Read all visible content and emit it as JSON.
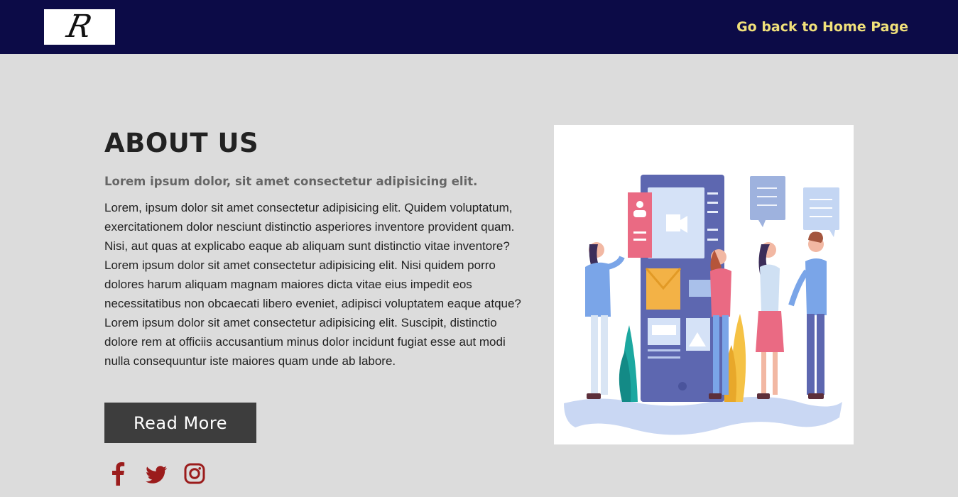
{
  "header": {
    "logo_letter": "R",
    "home_link": "Go back to Home Page"
  },
  "about": {
    "title": "ABOUT US",
    "subtitle": "Lorem ipsum dolor, sit amet consectetur adipisicing elit.",
    "body": "Lorem, ipsum dolor sit amet consectetur adipisicing elit. Quidem voluptatum, exercitationem dolor nesciunt distinctio asperiores inventore provident quam. Nisi, aut quas at explicabo eaque ab aliquam sunt distinctio vitae inventore? Lorem ipsum dolor sit amet consectetur adipisicing elit. Nisi quidem porro dolores harum aliquam magnam maiores dicta vitae eius impedit eos necessitatibus non obcaecati libero eveniet, adipisci voluptatem eaque atque? Lorem ipsum dolor sit amet consectetur adipisicing elit. Suscipit, distinctio dolore rem at officiis accusantium minus dolor incidunt fugiat esse aut modi nulla consequuntur iste maiores quam unde ab labore.",
    "button_label": "Read More"
  },
  "socials": [
    {
      "icon": "facebook-icon"
    },
    {
      "icon": "twitter-icon"
    },
    {
      "icon": "instagram-icon"
    }
  ],
  "colors": {
    "header_bg": "#0c0b47",
    "link": "#f0e07a",
    "page_bg": "#dcdcdc",
    "button_bg": "#3d3d3d",
    "social": "#9b1c1c"
  }
}
